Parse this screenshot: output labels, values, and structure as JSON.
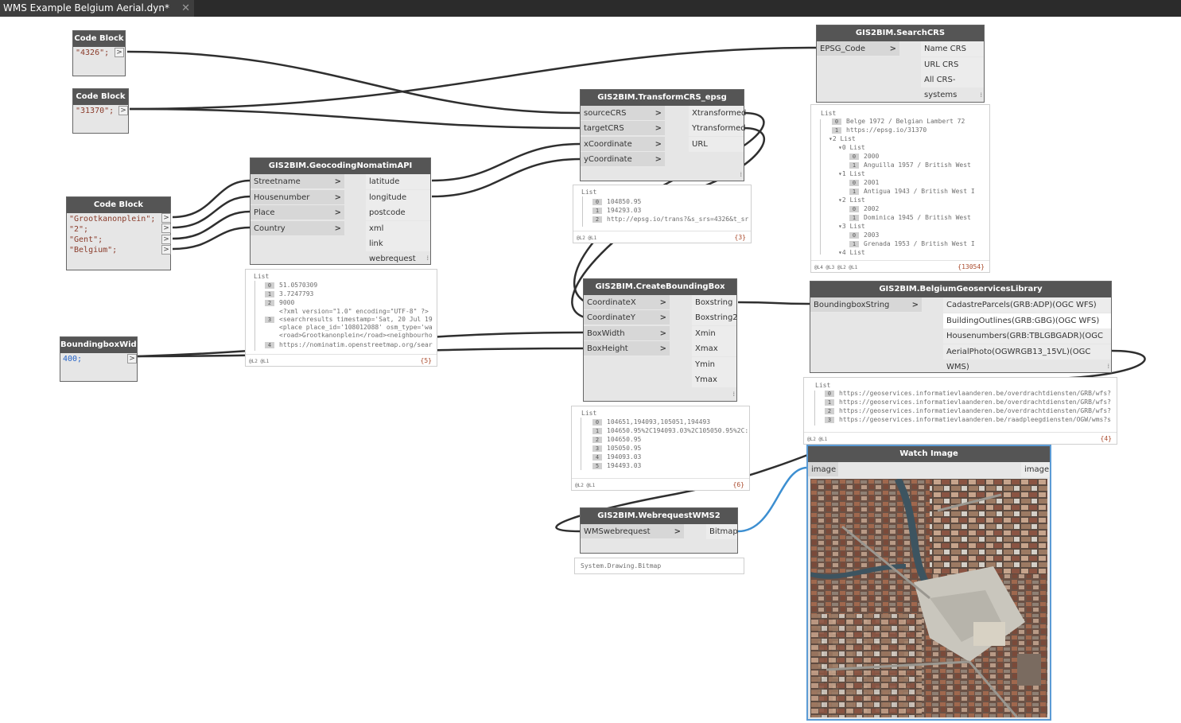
{
  "window": {
    "tab_title": "WMS Example Belgium Aerial.dyn*",
    "close_glyph": "✕"
  },
  "port_arrow": ">",
  "code_blocks": {
    "cb1": {
      "title": "Code Block",
      "lines": [
        "\"4326\";"
      ]
    },
    "cb2": {
      "title": "Code Block",
      "lines": [
        "\"31370\";"
      ]
    },
    "cb3": {
      "title": "Code Block",
      "lines": [
        "\"Grootkanonplein\";",
        "\"2\";",
        "\"Gent\";",
        "\"Belgium\";"
      ]
    },
    "cb4": {
      "title": "BoundingboxWidth",
      "lines": [
        "400;"
      ]
    }
  },
  "nodes": {
    "search_crs": {
      "title": "GIS2BIM.SearchCRS",
      "inputs": [
        "EPSG_Code"
      ],
      "outputs": [
        "Name CRS",
        "URL CRS",
        "All CRS-systems"
      ]
    },
    "transform": {
      "title": "GIS2BIM.TransformCRS_epsg",
      "inputs": [
        "sourceCRS",
        "targetCRS",
        "xCoordinate",
        "yCoordinate"
      ],
      "outputs": [
        "Xtransformed",
        "Ytransformed",
        "URL"
      ]
    },
    "geocoding": {
      "title": "GIS2BIM.GeocodingNomatimAPI",
      "inputs": [
        "Streetname",
        "Housenumber",
        "Place",
        "Country"
      ],
      "outputs": [
        "latitude",
        "longitude",
        "postcode",
        "xml",
        "link webrequest"
      ]
    },
    "bbox": {
      "title": "GIS2BIM.CreateBoundingBox",
      "inputs": [
        "CoordinateX",
        "CoordinateY",
        "BoxWidth",
        "BoxHeight"
      ],
      "outputs": [
        "Boxstring",
        "Boxstring2",
        "Xmin",
        "Xmax",
        "Ymin",
        "Ymax"
      ]
    },
    "library": {
      "title": "GIS2BIM.BelgiumGeoservicesLibrary",
      "inputs": [
        "BoundingboxString"
      ],
      "outputs": [
        "CadastreParcels(GRB:ADP)(OGC WFS)",
        "BuildingOutlines(GRB:GBG)(OGC WFS)",
        "Housenumbers(GRB:TBLGBGADR)(OGC WFS)",
        "AerialPhoto(OGWRGB13_15VL)(OGC WMS)"
      ]
    },
    "wms": {
      "title": "GIS2BIM.WebrequestWMS2",
      "inputs": [
        "WMSwebrequest"
      ],
      "outputs": [
        "Bitmap"
      ]
    },
    "watch": {
      "title": "Watch Image",
      "input": "image",
      "output": "image"
    }
  },
  "previews": {
    "geocoding": {
      "header": "List",
      "rows": [
        [
          "0",
          "51.0570309"
        ],
        [
          "1",
          "3.7247793"
        ],
        [
          "2",
          "9000"
        ],
        [
          "",
          "<?xml version=\"1.0\" encoding=\"UTF-8\" ?>"
        ],
        [
          "3",
          "<searchresults timestamp='Sat, 20 Jul 19"
        ],
        [
          "",
          "<place place_id='108012088' osm_type='wa"
        ],
        [
          "",
          "<road>Grootkanonplein</road><neighbourho"
        ],
        [
          "4",
          "https://nominatim.openstreetmap.org/sear"
        ]
      ],
      "levels": "@L2 @L1",
      "count": "{5}"
    },
    "transform": {
      "header": "List",
      "rows": [
        [
          "0",
          "104850.95"
        ],
        [
          "1",
          "194293.03"
        ],
        [
          "2",
          "http://epsg.io/trans?&s_srs=4326&t_sr"
        ]
      ],
      "levels": "@L2 @L1",
      "count": "{3}"
    },
    "search": {
      "header": "List",
      "rows": [
        [
          "0",
          "Belge 1972 / Belgian Lambert 72"
        ],
        [
          "1",
          "https://epsg.io/31370"
        ],
        [
          "▾2",
          "List"
        ],
        [
          "▾0",
          "List"
        ],
        [
          "0",
          "2000"
        ],
        [
          "1",
          "Anguilla 1957 / British West"
        ],
        [
          "▾1",
          "List"
        ],
        [
          "0",
          "2001"
        ],
        [
          "1",
          "Antigua 1943 / British West I"
        ],
        [
          "▾2",
          "List"
        ],
        [
          "0",
          "2002"
        ],
        [
          "1",
          "Dominica 1945 / British West"
        ],
        [
          "▾3",
          "List"
        ],
        [
          "0",
          "2003"
        ],
        [
          "1",
          "Grenada 1953 / British West I"
        ],
        [
          "▾4",
          "List"
        ]
      ],
      "levels": "@L4 @L3 @L2 @L1",
      "count": "{13054}"
    },
    "bbox": {
      "header": "List",
      "rows": [
        [
          "0",
          "104651,194093,105051,194493"
        ],
        [
          "1",
          "104650.95%2C194093.03%2C105050.95%2C:"
        ],
        [
          "2",
          "104650.95"
        ],
        [
          "3",
          "105050.95"
        ],
        [
          "4",
          "194093.03"
        ],
        [
          "5",
          "194493.03"
        ]
      ],
      "levels": "@L2 @L1",
      "count": "{6}"
    },
    "library": {
      "header": "List",
      "rows": [
        [
          "0",
          "https://geoservices.informatievlaanderen.be/overdrachtdiensten/GRB/wfs?"
        ],
        [
          "1",
          "https://geoservices.informatievlaanderen.be/overdrachtdiensten/GRB/wfs?"
        ],
        [
          "2",
          "https://geoservices.informatievlaanderen.be/overdrachtdiensten/GRB/wfs?"
        ],
        [
          "3",
          "https://geoservices.informatievlaanderen.be/raadpleegdiensten/OGW/wms?s"
        ]
      ],
      "levels": "@L2 @L1",
      "count": "{4}"
    },
    "wms": {
      "value": "System.Drawing.Bitmap"
    }
  },
  "colors": {
    "header": "#555555",
    "wire": "#2f2f2f",
    "selected_wire": "#3d8fd1",
    "selected_border": "#5b9bd5"
  }
}
